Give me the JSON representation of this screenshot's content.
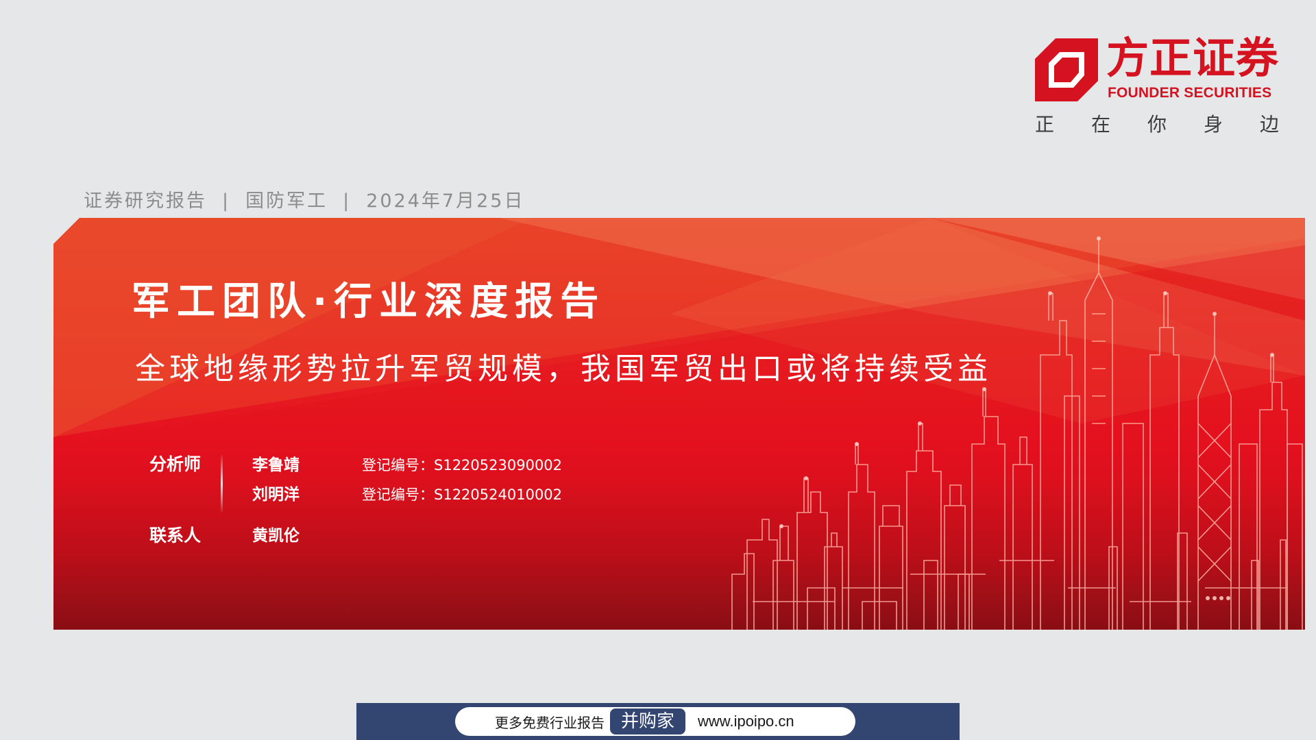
{
  "logo": {
    "name_cn": "方正证券",
    "name_en": "FOUNDER SECURITIES",
    "slogan": [
      "正",
      "在",
      "你",
      "身",
      "边"
    ],
    "brand_color": "#d5121f"
  },
  "meta": {
    "report_type": "证券研究报告",
    "sector": "国防军工",
    "date": "2024年7月25日"
  },
  "banner": {
    "title": "军工团队·行业深度报告",
    "subtitle": "全球地缘形势拉升军贸规模，我国军贸出口或将持续受益",
    "analyst_label": "分析师",
    "analysts": [
      {
        "name": "李鲁靖",
        "registration": "登记编号：S1220523090002"
      },
      {
        "name": "刘明洋",
        "registration": "登记编号：S1220524010002"
      }
    ],
    "contact_label": "联系人",
    "contact": "黄凯伦"
  },
  "footer": {
    "text": "更多免费行业报告",
    "brand": "并购家",
    "url": "www.ipoipo.cn"
  }
}
